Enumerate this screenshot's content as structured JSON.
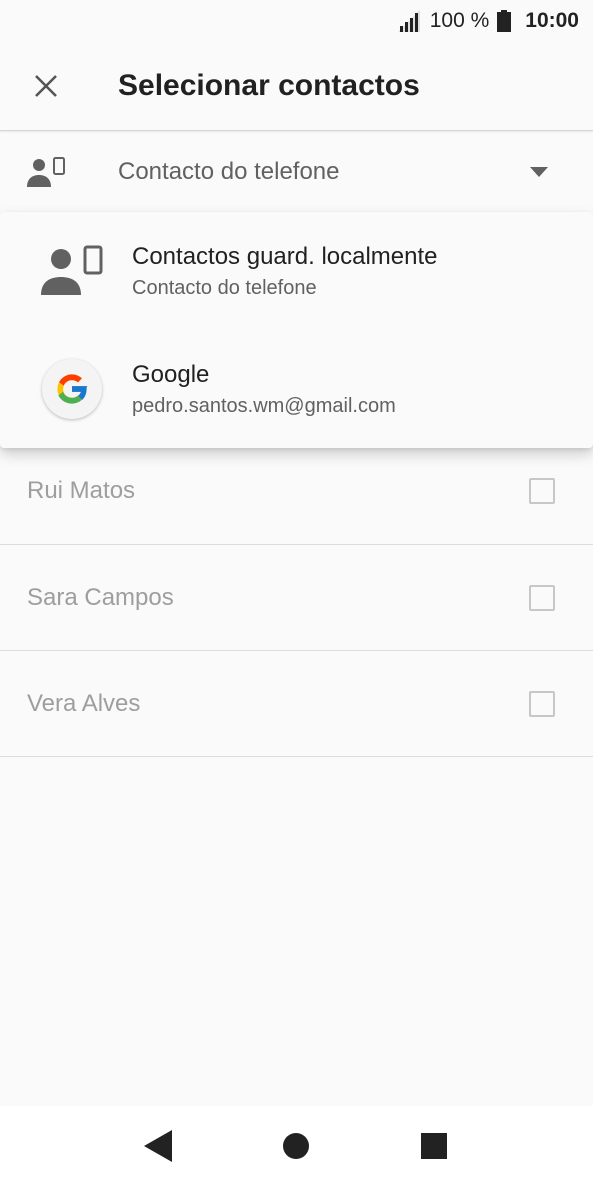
{
  "status_bar": {
    "battery_text": "100 %",
    "time": "10:00",
    "icons": [
      "signal-icon",
      "battery-icon"
    ]
  },
  "app_bar": {
    "title": "Selecionar contactos",
    "close_icon": "close-icon"
  },
  "account_selector": {
    "selected": "Contacto do telefone",
    "icon": "phone-contact-icon",
    "caret_icon": "caret-down-icon"
  },
  "dropdown": {
    "items": [
      {
        "title": "Contactos guard. localmente",
        "subtitle": "Contacto do telefone",
        "icon": "phone-contact-icon"
      },
      {
        "title": "Google",
        "subtitle": "pedro.santos.wm@gmail.com",
        "icon": "google-icon"
      }
    ]
  },
  "contacts": [
    {
      "name": "Rui Matos",
      "checked": false
    },
    {
      "name": "Sara Campos",
      "checked": false
    },
    {
      "name": "Vera Alves",
      "checked": false
    }
  ],
  "nav_bar": {
    "icons": [
      "back-icon",
      "home-icon",
      "recents-icon"
    ]
  },
  "colors": {
    "background": "#fafafa",
    "text_primary": "#212121",
    "text_secondary": "#616161",
    "text_dimmed": "#9e9e9e",
    "icon_gray": "#616161"
  }
}
